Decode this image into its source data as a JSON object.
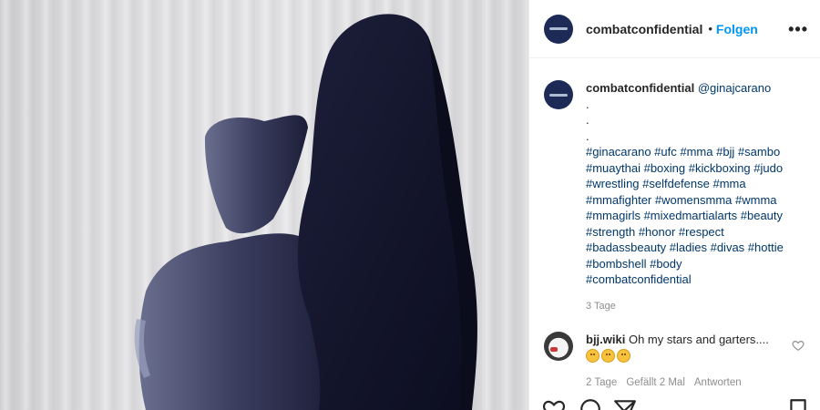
{
  "header": {
    "username": "combatconfidential",
    "separator": "•",
    "follow_label": "Folgen",
    "more_label": "•••"
  },
  "caption": {
    "username": "combatconfidential",
    "mention": "@ginajcarano",
    "dots": [
      ".",
      ".",
      "."
    ],
    "hashtags": [
      "#ginacarano #ufc #mma #bjj #sambo",
      "#muaythai #boxing #kickboxing #judo",
      "#wrestling #selfdefense #mma",
      "#mmafighter #womensmma #wmma",
      "#mmagirls #mixedmartialarts #beauty",
      "#strength #honor #respect",
      "#badassbeauty #ladies #divas #hottie",
      "#bombshell #body",
      "#combatconfidential"
    ],
    "time": "3 Tage"
  },
  "comment": {
    "username": "bjj.wiki",
    "text": "Oh my stars and garters....",
    "time": "2 Tage",
    "likes": "Gefällt 2 Mal",
    "reply_label": "Antworten",
    "emoji_count": 3
  },
  "icons": {
    "header_avatar": "avatar-icon",
    "heart": "heart-icon",
    "more": "more-options-icon",
    "like": "like-icon",
    "comment": "comment-icon",
    "share": "share-icon",
    "save": "save-icon"
  },
  "colors": {
    "link": "#0095f6",
    "hashtag": "#00376b",
    "muted": "#8e8e8e",
    "avatar_bg": "#1c2a55"
  }
}
